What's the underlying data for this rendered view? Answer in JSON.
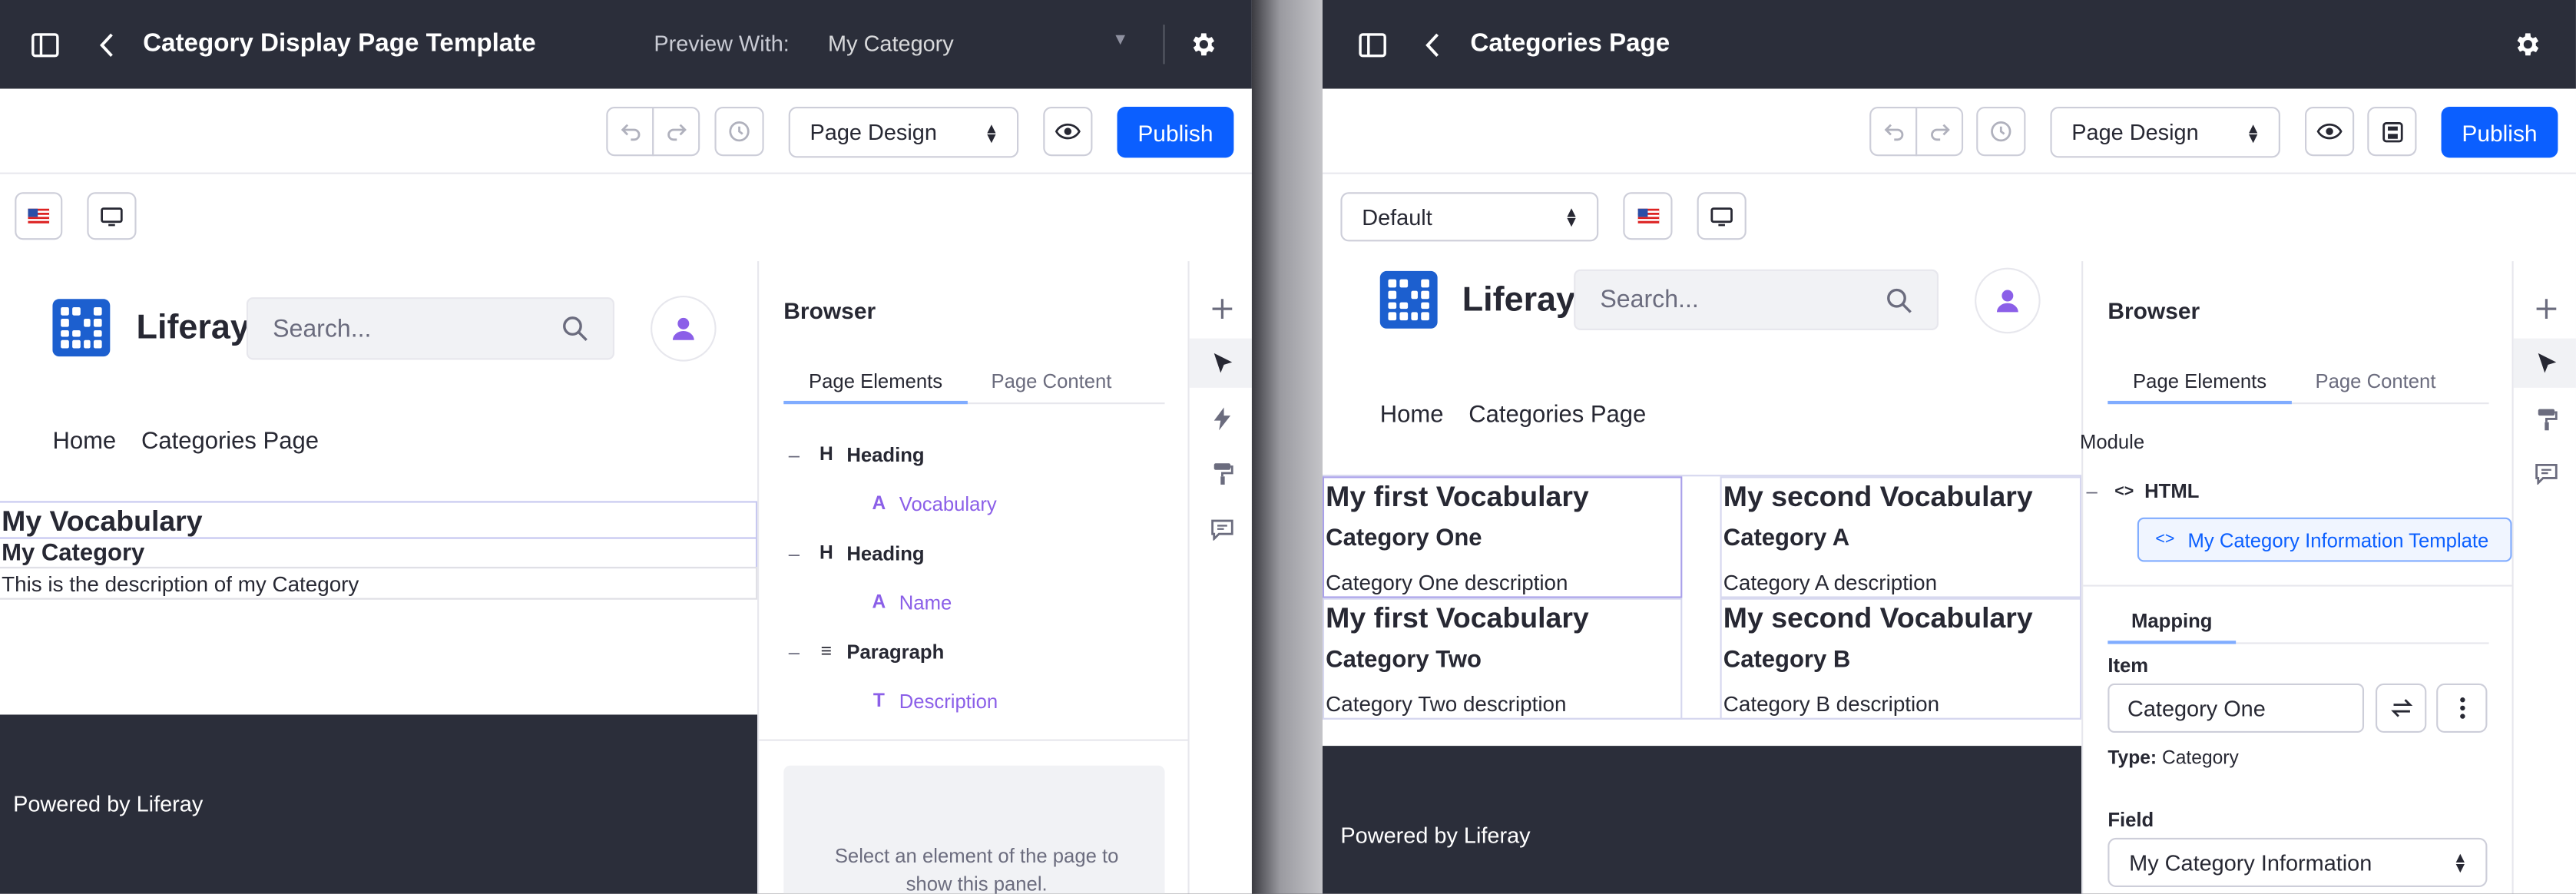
{
  "left": {
    "title": "Category Display Page Template",
    "preview_label": "Preview With:",
    "preview_value": "My Category",
    "mode_select": "Page Design",
    "publish": "Publish",
    "brand": "Liferay",
    "search_placeholder": "Search...",
    "nav": [
      "Home",
      "Categories Page"
    ],
    "content": {
      "vocabulary": "My Vocabulary",
      "category": "My Category",
      "description": "This is the description of my Category"
    },
    "footer": "Powered by Liferay",
    "browser": {
      "title": "Browser",
      "tabs": [
        "Page Elements",
        "Page Content"
      ],
      "tree": [
        {
          "level": 0,
          "icon": "H",
          "label": "Heading"
        },
        {
          "level": 1,
          "icon": "A",
          "label": "Vocabulary"
        },
        {
          "level": 0,
          "icon": "¶",
          "label": "Heading"
        },
        {
          "level": 1,
          "icon": "A",
          "label": "Name"
        },
        {
          "level": 0,
          "icon": "≡",
          "label": "Paragraph"
        },
        {
          "level": 1,
          "icon": "Tт",
          "label": "Description"
        }
      ],
      "empty_hint": "Select an element of the page to show this panel."
    }
  },
  "right": {
    "title": "Categories Page",
    "mode_select": "Page Design",
    "publish": "Publish",
    "experience_select": "Default",
    "brand": "Liferay",
    "search_placeholder": "Search...",
    "nav": [
      "Home",
      "Categories Page"
    ],
    "cards": [
      {
        "vocabulary": "My first Vocabulary",
        "category": "Category One",
        "description": "Category One description"
      },
      {
        "vocabulary": "My second Vocabulary",
        "category": "Category A",
        "description": "Category A description"
      },
      {
        "vocabulary": "My first Vocabulary",
        "category": "Category Two",
        "description": "Category Two description"
      },
      {
        "vocabulary": "My second Vocabulary",
        "category": "Category B",
        "description": "Category B description"
      }
    ],
    "footer": "Powered by Liferay",
    "browser": {
      "title": "Browser",
      "tabs": [
        "Page Elements",
        "Page Content"
      ],
      "module_label": "Module",
      "html_label": "HTML",
      "template_label": "My Category Information Template",
      "mapping_tab": "Mapping",
      "item_label": "Item",
      "item_value": "Category One",
      "type_label": "Type:",
      "type_value": "Category",
      "field_label": "Field",
      "field_value": "My Category Information"
    }
  },
  "colors": {
    "topbar": "#2b2e3a",
    "primary": "#0b5fff",
    "accent_purple": "#8b5fe8",
    "footer": "#2b2e3a"
  },
  "icons": [
    "sidebar-toggle-icon",
    "back-chevron-icon",
    "gear-icon",
    "undo-icon",
    "redo-icon",
    "history-icon",
    "eye-icon",
    "flag-us-icon",
    "desktop-icon",
    "search-icon",
    "user-icon",
    "plus-icon",
    "cursor-icon",
    "bolt-icon",
    "paint-roller-icon",
    "comment-icon",
    "swap-icon",
    "kebab-icon",
    "code-icon",
    "save-icon"
  ]
}
